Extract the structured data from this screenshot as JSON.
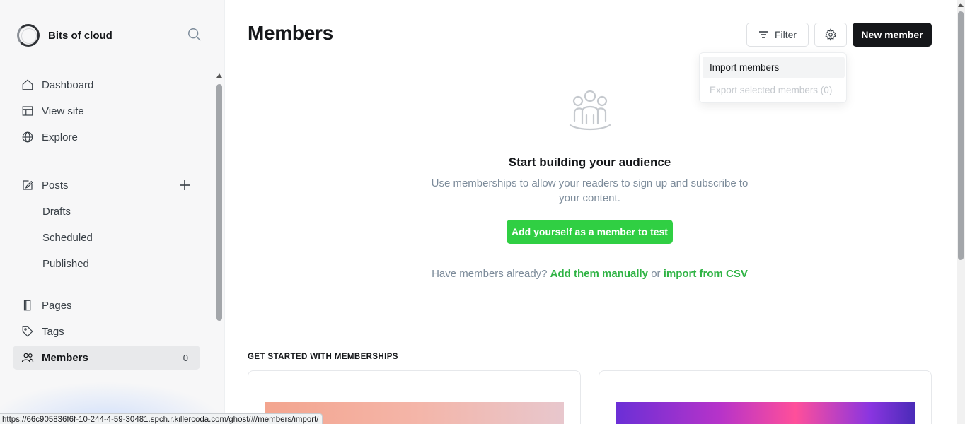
{
  "sidebar": {
    "brand_name": "Bits of cloud",
    "items": [
      {
        "label": "Dashboard",
        "icon": "home-icon"
      },
      {
        "label": "View site",
        "icon": "layout-icon"
      },
      {
        "label": "Explore",
        "icon": "globe-icon"
      },
      {
        "label": "Posts",
        "icon": "edit-icon"
      },
      {
        "label": "Drafts"
      },
      {
        "label": "Scheduled"
      },
      {
        "label": "Published"
      },
      {
        "label": "Pages",
        "icon": "page-icon"
      },
      {
        "label": "Tags",
        "icon": "tag-icon"
      },
      {
        "label": "Members",
        "icon": "members-icon",
        "count": "0",
        "active": true
      }
    ]
  },
  "header": {
    "title": "Members",
    "filter_label": "Filter",
    "new_member_label": "New member"
  },
  "dropdown": {
    "import_label": "Import members",
    "export_label": "Export selected members (0)"
  },
  "empty_state": {
    "title": "Start building your audience",
    "description": "Use memberships to allow your readers to sign up and subscribe to your content.",
    "cta_label": "Add yourself as a member to test",
    "already_prefix": "Have members already?",
    "add_manually": "Add them manually",
    "or": "or",
    "import_csv": "import from CSV"
  },
  "get_started": {
    "label": "GET STARTED WITH MEMBERSHIPS"
  },
  "status_bar": {
    "url": "https://66c905836f6f-10-244-4-59-30481.spch.r.killercoda.com/ghost/#/members/import/"
  },
  "colors": {
    "accent_green": "#30cf43",
    "link_green": "#2fb344",
    "primary_dark": "#15171a"
  }
}
